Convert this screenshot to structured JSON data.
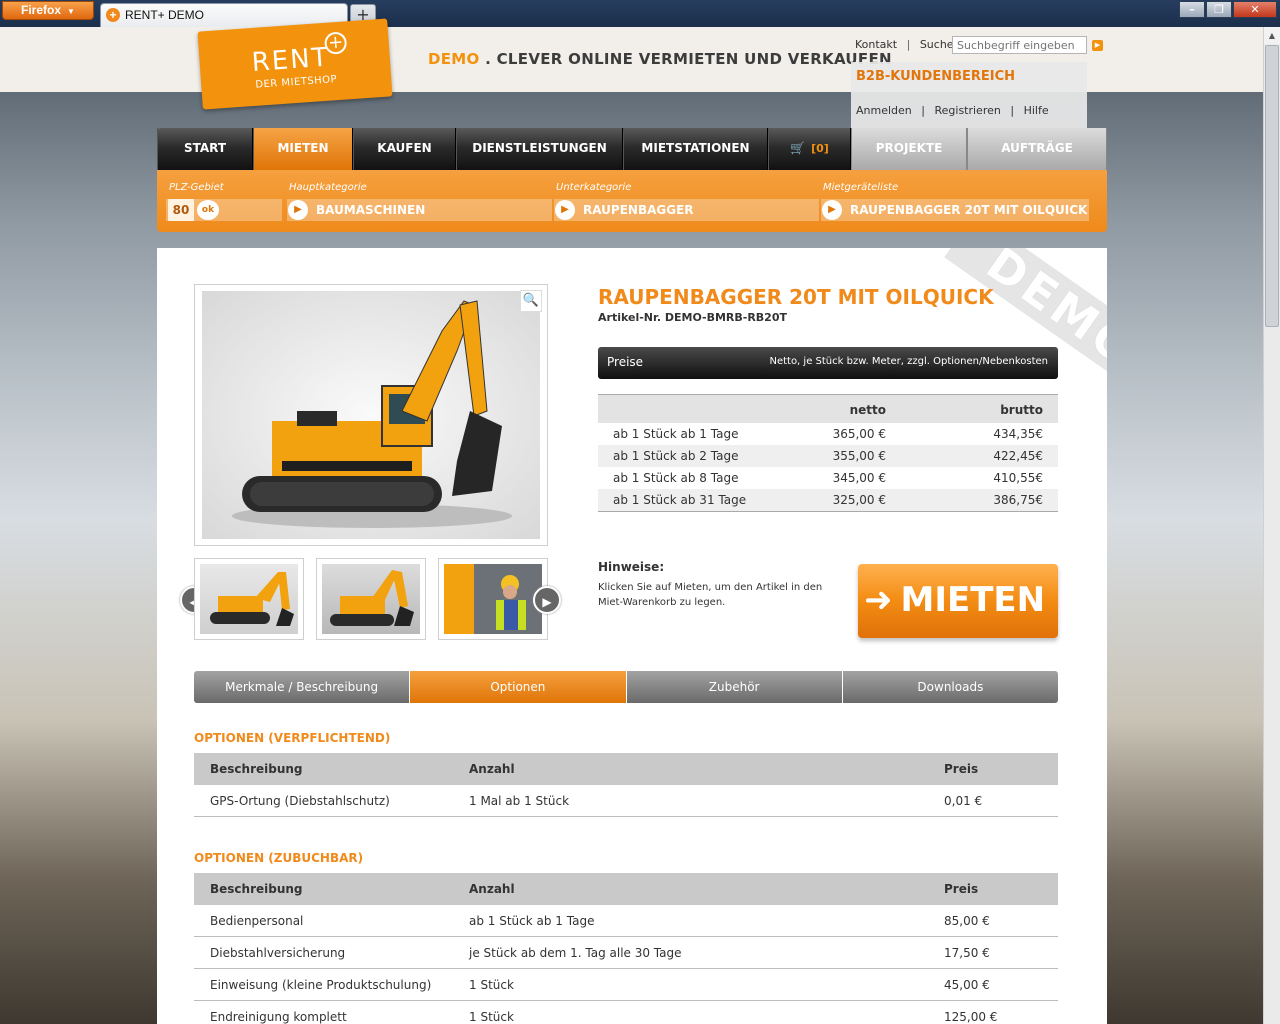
{
  "browser": {
    "menu_button": "Firefox",
    "tab_title": "RENT+ DEMO",
    "new_tab": "+"
  },
  "header": {
    "logo_word": "RENT",
    "logo_plus": "+",
    "logo_sub": "DER MIETSHOP",
    "tagline_demo": "DEMO",
    "tagline_rest": " . CLEVER ONLINE VERMIETEN UND VERKAUFEN",
    "link_kontakt": "Kontakt",
    "link_suche": "Suche",
    "search_placeholder": "Suchbegriff eingeben",
    "separator": "|"
  },
  "b2b": {
    "title": "B2B-KUNDENBEREICH",
    "login": "Anmelden",
    "register": "Registrieren",
    "help": "Hilfe"
  },
  "nav": {
    "start": "START",
    "mieten": "MIETEN",
    "kaufen": "KAUFEN",
    "dienstleistungen": "DIENSTLEISTUNGEN",
    "mietstationen": "MIETSTATIONEN",
    "cart_count": "[0]",
    "projekte": "PROJEKTE",
    "auftraege": "AUFTRÄGE"
  },
  "filter": {
    "plz_label": "PLZ-Gebiet",
    "plz_value": "80",
    "ok": "ok",
    "haupt_label": "Hauptkategorie",
    "haupt_value": "BAUMASCHINEN",
    "unter_label": "Unterkategorie",
    "unter_value": "RAUPENBAGGER",
    "liste_label": "Mietgeräteliste",
    "liste_value": "RAUPENBAGGER 20T MIT OILQUICK"
  },
  "product": {
    "ribbon": "DEMO",
    "title": "RAUPENBAGGER 20T MIT OILQUICK",
    "article_no": "Artikel-Nr. DEMO-BMRB-RB20T",
    "prices_label": "Preise",
    "prices_note": "Netto, je Stück bzw. Meter, zzgl. Optionen/Nebenkosten",
    "col_netto": "netto",
    "col_brutto": "brutto",
    "prices": [
      {
        "label": "ab 1 Stück ab 1 Tage",
        "netto": "365,00 €",
        "brutto": "434,35€"
      },
      {
        "label": "ab 1 Stück ab 2 Tage",
        "netto": "355,00 €",
        "brutto": "422,45€"
      },
      {
        "label": "ab 1 Stück ab 8 Tage",
        "netto": "345,00 €",
        "brutto": "410,55€"
      },
      {
        "label": "ab 1 Stück ab 31 Tage",
        "netto": "325,00 €",
        "brutto": "386,75€"
      }
    ],
    "hint_title": "Hinweise:",
    "hint_text": "Klicken Sie auf Mieten, um den Artikel in den Miet-Warenkorb zu legen.",
    "rent_button": "MIETEN"
  },
  "tabs": {
    "merkmale": "Merkmale / Beschreibung",
    "optionen": "Optionen",
    "zubehoer": "Zubehör",
    "downloads": "Downloads"
  },
  "options_required": {
    "title": "OPTIONEN (VERPFLICHTEND)",
    "col_desc": "Beschreibung",
    "col_qty": "Anzahl",
    "col_price": "Preis",
    "rows": [
      {
        "desc": "GPS-Ortung (Diebstahlschutz)",
        "qty": "1 Mal ab 1 Stück",
        "price": "0,01 €"
      }
    ]
  },
  "options_optional": {
    "title": "OPTIONEN (ZUBUCHBAR)",
    "col_desc": "Beschreibung",
    "col_qty": "Anzahl",
    "col_price": "Preis",
    "rows": [
      {
        "desc": "Bedienpersonal",
        "qty": "ab 1 Stück ab 1 Tage",
        "price": "85,00 €"
      },
      {
        "desc": "Diebstahlversicherung",
        "qty": "je Stück ab dem 1. Tag alle 30 Tage",
        "price": "17,50 €"
      },
      {
        "desc": "Einweisung (kleine Produktschulung)",
        "qty": "1 Stück",
        "price": "45,00 €"
      },
      {
        "desc": "Endreinigung komplett",
        "qty": "1 Stück",
        "price": "125,00 €"
      }
    ]
  },
  "colors": {
    "accent": "#f2920d",
    "nav_dark": "#1a1a1a",
    "table_head": "#c9c9c9"
  }
}
